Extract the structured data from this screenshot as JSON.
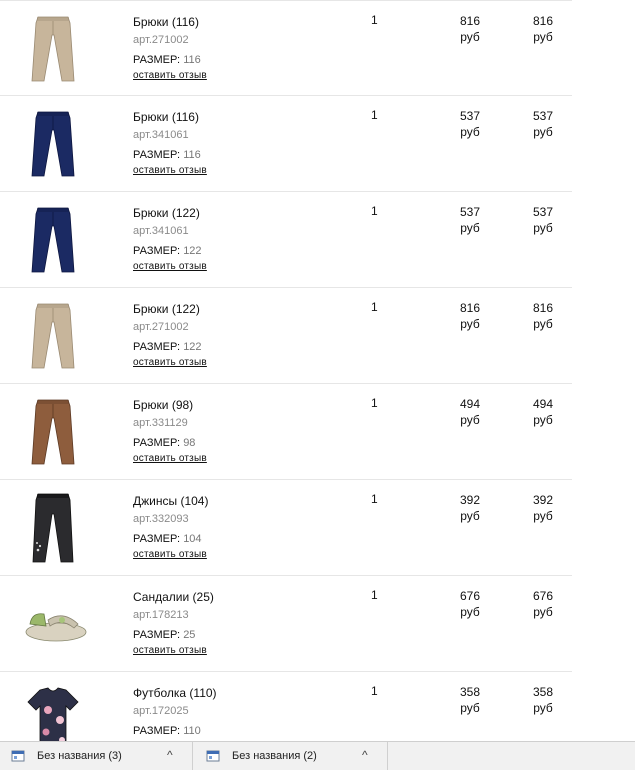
{
  "orders": [
    {
      "title": "Брюки (116)",
      "art": "арт.271002",
      "size_label": "РАЗМЕР:",
      "size": "116",
      "review": "оставить отзыв",
      "qty": "1",
      "price": "816",
      "price_unit": "руб",
      "total": "816",
      "total_unit": "руб",
      "image": "beige-pants"
    },
    {
      "title": "Брюки (116)",
      "art": "арт.341061",
      "size_label": "РАЗМЕР:",
      "size": "116",
      "review": "оставить отзыв",
      "qty": "1",
      "price": "537",
      "price_unit": "руб",
      "total": "537",
      "total_unit": "руб",
      "image": "navy-pants"
    },
    {
      "title": "Брюки (122)",
      "art": "арт.341061",
      "size_label": "РАЗМЕР:",
      "size": "122",
      "review": "оставить отзыв",
      "qty": "1",
      "price": "537",
      "price_unit": "руб",
      "total": "537",
      "total_unit": "руб",
      "image": "navy-pants"
    },
    {
      "title": "Брюки (122)",
      "art": "арт.271002",
      "size_label": "РАЗМЕР:",
      "size": "122",
      "review": "оставить отзыв",
      "qty": "1",
      "price": "816",
      "price_unit": "руб",
      "total": "816",
      "total_unit": "руб",
      "image": "beige-pants"
    },
    {
      "title": "Брюки (98)",
      "art": "арт.331129",
      "size_label": "РАЗМЕР:",
      "size": "98",
      "review": "оставить отзыв",
      "qty": "1",
      "price": "494",
      "price_unit": "руб",
      "total": "494",
      "total_unit": "руб",
      "image": "brown-pants"
    },
    {
      "title": "Джинсы (104)",
      "art": "арт.332093",
      "size_label": "РАЗМЕР:",
      "size": "104",
      "review": "оставить отзыв",
      "qty": "1",
      "price": "392",
      "price_unit": "руб",
      "total": "392",
      "total_unit": "руб",
      "image": "black-jeans"
    },
    {
      "title": "Сандалии (25)",
      "art": "арт.178213",
      "size_label": "РАЗМЕР:",
      "size": "25",
      "review": "оставить отзыв",
      "qty": "1",
      "price": "676",
      "price_unit": "руб",
      "total": "676",
      "total_unit": "руб",
      "image": "sandal"
    },
    {
      "title": "Футболка (110)",
      "art": "арт.172025",
      "size_label": "РАЗМЕР:",
      "size": "110",
      "review": "",
      "qty": "1",
      "price": "358",
      "price_unit": "руб",
      "total": "358",
      "total_unit": "руб",
      "image": "floral-tshirt"
    }
  ],
  "downloads": [
    {
      "name": "Без названия (3)",
      "icon": "image-file-icon",
      "chevron": "^"
    },
    {
      "name": "Без названия (2)",
      "icon": "image-file-icon",
      "chevron": "^"
    }
  ],
  "colors": {
    "beige": "#c7b59b",
    "navy": "#1b2a63",
    "brown": "#8e5d3d",
    "black": "#2b2b2e",
    "divider": "#e6e6e6",
    "muted": "#8a8a8a"
  }
}
